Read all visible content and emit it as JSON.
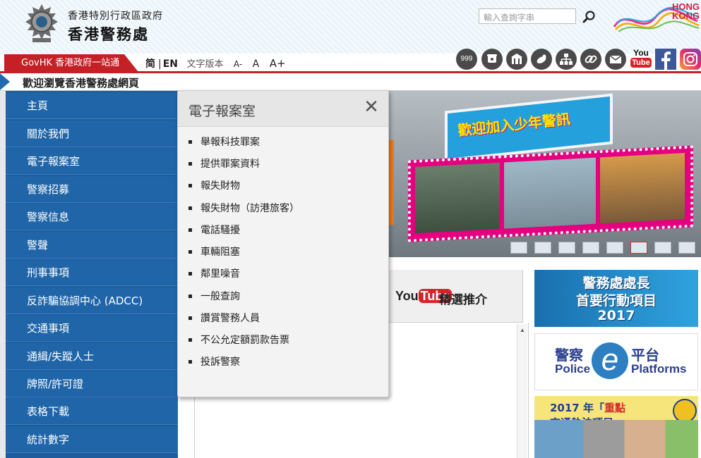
{
  "header": {
    "gov_name": "香港特別行政區政府",
    "police_name": "香港警務處",
    "search_placeholder": "輸入查詢字串",
    "brand_text": "HONG KONG"
  },
  "toolbar": {
    "govhk": "GovHK 香港政府一站通",
    "lang_sc": "简",
    "lang_en": "EN",
    "text_version": "文字版本",
    "font_small": "A-",
    "font_medium": "A",
    "font_large": "A+",
    "emergency": "999",
    "icons": [
      "phone-icon",
      "building-icon",
      "handshake-icon",
      "sitemap-icon",
      "link-icon",
      "mail-icon",
      "youtube-icon",
      "facebook-icon",
      "instagram-icon"
    ],
    "youtube_top": "You",
    "youtube_bottom": "Tube"
  },
  "welcome": "歡迎瀏覽香港警務處網頁",
  "sidebar": {
    "items": [
      {
        "label": "主頁"
      },
      {
        "label": "關於我們"
      },
      {
        "label": "電子報案室"
      },
      {
        "label": "警察招募"
      },
      {
        "label": "警察信息"
      },
      {
        "label": "警聲"
      },
      {
        "label": "刑事事項"
      },
      {
        "label": "反詐騙協調中心 (ADCC)"
      },
      {
        "label": "交通事項"
      },
      {
        "label": "通緝/失蹤人士"
      },
      {
        "label": "牌照/許可證"
      },
      {
        "label": "表格下載"
      },
      {
        "label": "統計數字"
      }
    ]
  },
  "banner": {
    "title": "歡迎加入少年警訊"
  },
  "youtube": {
    "logo_you": "You",
    "logo_tube": "Tube",
    "label": "精選推介"
  },
  "right": {
    "b1_l1": "警務處處長",
    "b1_l2": "首要行動項目",
    "b1_l3": "2017",
    "b2_a": "警察",
    "b2_b": "Police",
    "b2_e": "e",
    "b2_c": "平台",
    "b2_d": "Platforms",
    "b3_pre": "2017 年「",
    "b3_red": "重點",
    "b3_post": "交通執法項目」"
  },
  "popup": {
    "title": "電子報案室",
    "close": "✕",
    "items": [
      "舉報科技罪案",
      "提供罪案資料",
      "報失財物",
      "報失財物（訪港旅客）",
      "電話騷擾",
      "車輛阻塞",
      "鄰里噪音",
      "一般查詢",
      "讚賞警務人員",
      "不公允定額罰款告票",
      "投訴警察"
    ]
  },
  "colors": {
    "sidebar_bg": "#1f65a8",
    "govhk_red": "#c52026",
    "popup_bg": "#f3f3f3"
  }
}
